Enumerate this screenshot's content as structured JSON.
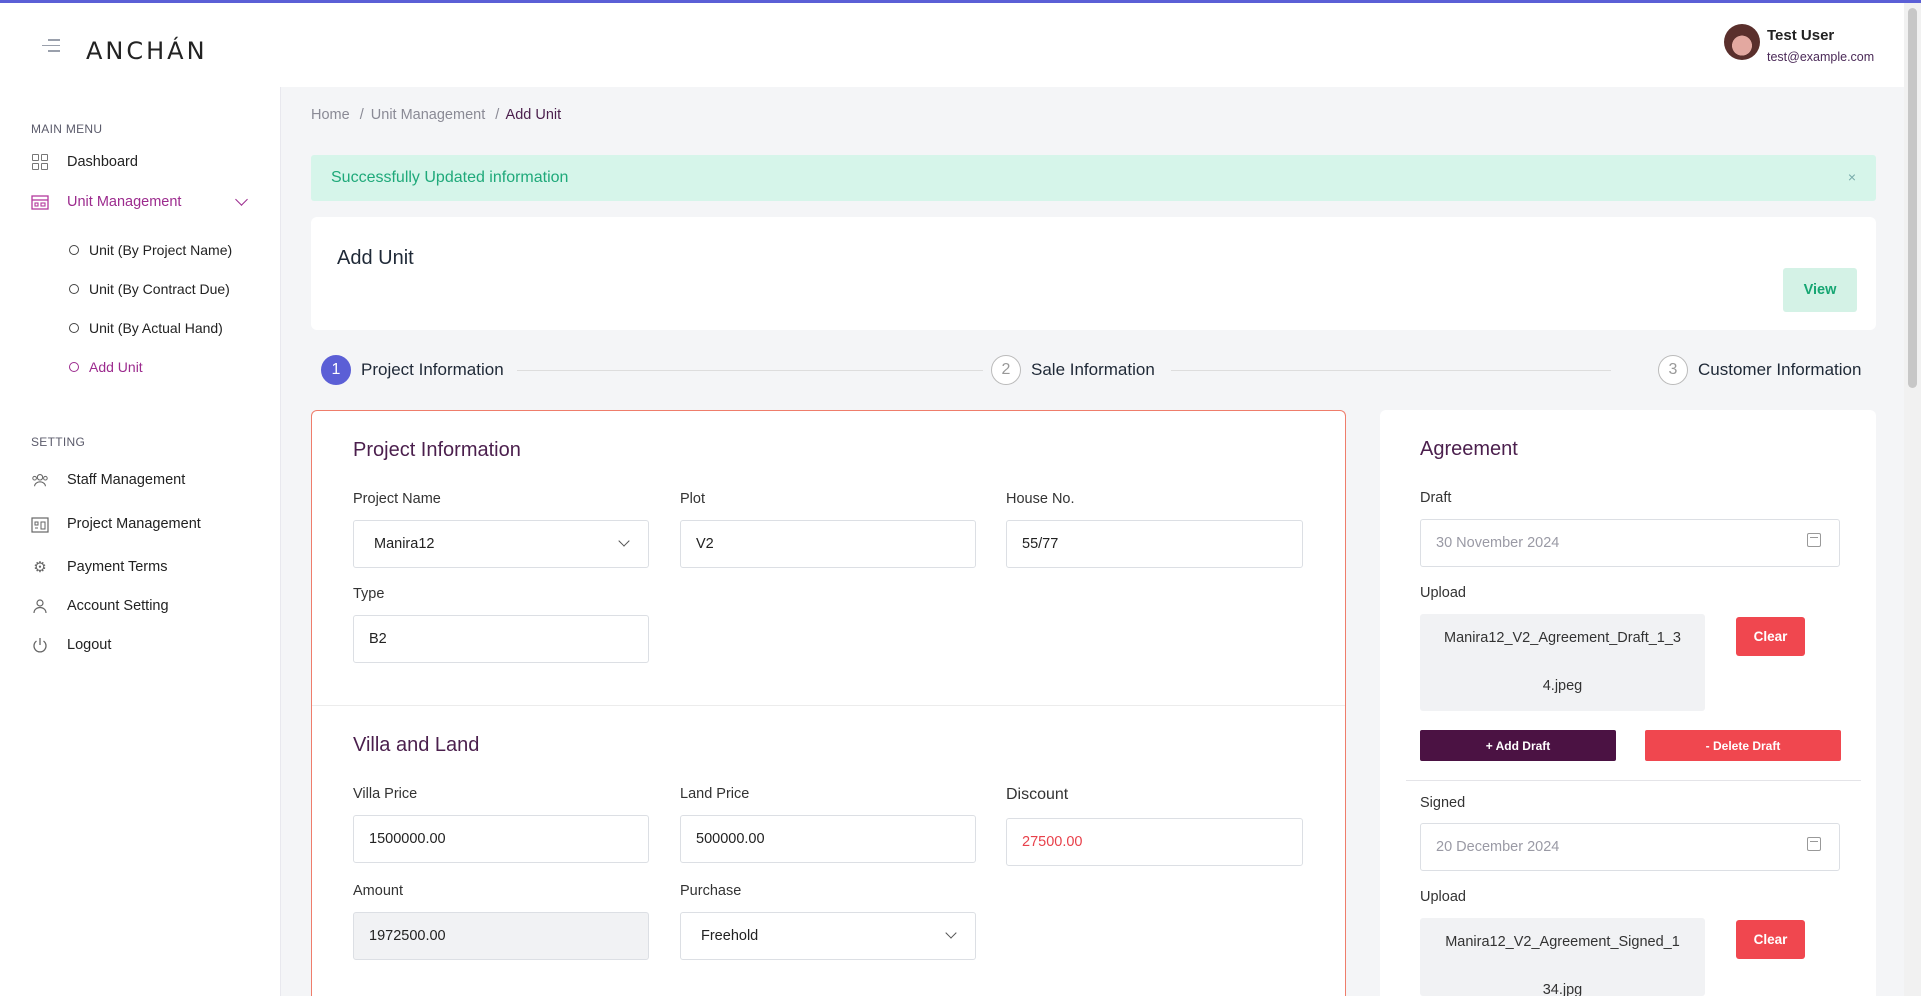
{
  "header": {
    "logo": "ANCHÁN",
    "user_name": "Test User",
    "user_email": "test@example.com"
  },
  "sidebar": {
    "main_menu_title": "MAIN MENU",
    "items": [
      {
        "label": "Dashboard",
        "icon": "grid-icon"
      },
      {
        "label": "Unit Management",
        "icon": "building-icon",
        "active": true
      }
    ],
    "sub_items": [
      {
        "label": "Unit (By Project Name)"
      },
      {
        "label": "Unit (By Contract Due)"
      },
      {
        "label": "Unit (By Actual Hand)"
      },
      {
        "label": "Add Unit",
        "active": true
      }
    ],
    "setting_title": "SETTING",
    "settings": [
      {
        "label": "Staff Management",
        "icon": "users-icon"
      },
      {
        "label": "Project Management",
        "icon": "project-icon"
      },
      {
        "label": "Payment Terms",
        "icon": "gear-icon"
      },
      {
        "label": "Account Setting",
        "icon": "user-icon"
      },
      {
        "label": "Logout",
        "icon": "power-icon"
      }
    ]
  },
  "breadcrumb": {
    "home": "Home",
    "section": "Unit Management",
    "current": "Add Unit",
    "sep": "/"
  },
  "alert": {
    "message": "Successfully Updated information",
    "close": "×"
  },
  "page": {
    "title": "Add Unit",
    "view_label": "View"
  },
  "steps": [
    {
      "num": "1",
      "label": "Project Information"
    },
    {
      "num": "2",
      "label": "Sale Information"
    },
    {
      "num": "3",
      "label": "Customer Information"
    }
  ],
  "project": {
    "title": "Project Information",
    "project_name_label": "Project Name",
    "project_name": "Manira12",
    "plot_label": "Plot",
    "plot": "V2",
    "house_label": "House No.",
    "house": "55/77",
    "type_label": "Type",
    "type": "B2"
  },
  "villa": {
    "title": "Villa and Land",
    "villa_price_label": "Villa Price",
    "villa_price": "1500000.00",
    "land_price_label": "Land Price",
    "land_price": "500000.00",
    "discount_label": "Discount",
    "discount": "27500.00",
    "amount_label": "Amount",
    "amount": "1972500.00",
    "purchase_label": "Purchase",
    "purchase": "Freehold"
  },
  "agreement": {
    "title": "Agreement",
    "draft_label": "Draft",
    "draft_date": "30 November 2024",
    "upload_label": "Upload",
    "draft_file_1": "Manira12_V2_Agreement_Draft_1_3",
    "draft_file_2": "4.jpeg",
    "clear_label": "Clear",
    "add_draft": "+ Add Draft",
    "delete_draft": "- Delete Draft",
    "signed_label": "Signed",
    "signed_date": "20 December 2024",
    "signed_upload_label": "Upload",
    "signed_file_1": "Manira12_V2_Agreement_Signed_1",
    "signed_file_2": "34.jpg",
    "signed_clear_label": "Clear"
  },
  "colors": {
    "accent": "#5b5fd6",
    "brand": "#4b1243",
    "active": "#9c2b8e",
    "danger": "#f0474f",
    "success": "#1fa97a"
  }
}
